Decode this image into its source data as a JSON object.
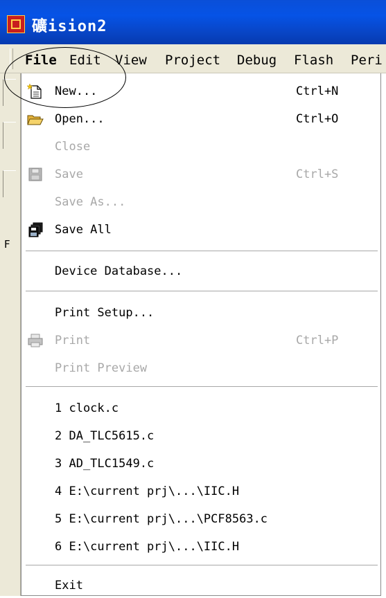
{
  "window": {
    "title": "礦ision2"
  },
  "menubar": {
    "items": [
      {
        "label": "File",
        "active": true
      },
      {
        "label": "Edit"
      },
      {
        "label": "View"
      },
      {
        "label": "Project"
      },
      {
        "label": "Debug"
      },
      {
        "label": "Flash"
      },
      {
        "label": "Peri"
      }
    ]
  },
  "left_panel": {
    "label": "F"
  },
  "file_menu": {
    "new": {
      "label": "New...",
      "shortcut": "Ctrl+N",
      "icon": "new-file-icon"
    },
    "open": {
      "label": "Open...",
      "shortcut": "Ctrl+O",
      "icon": "folder-open-icon"
    },
    "close": {
      "label": "Close"
    },
    "save": {
      "label": "Save",
      "shortcut": "Ctrl+S",
      "icon": "save-disk-icon"
    },
    "save_as": {
      "label": "Save As..."
    },
    "save_all": {
      "label": "Save All",
      "icon": "save-all-icon"
    },
    "device_database": {
      "label": "Device Database..."
    },
    "print_setup": {
      "label": "Print Setup..."
    },
    "print": {
      "label": "Print",
      "shortcut": "Ctrl+P",
      "icon": "printer-icon"
    },
    "print_preview": {
      "label": "Print Preview"
    },
    "recent": [
      {
        "label": "1 clock.c"
      },
      {
        "label": "2 DA_TLC5615.c"
      },
      {
        "label": "3 AD_TLC1549.c"
      },
      {
        "label": "4 E:\\current prj\\...\\IIC.H"
      },
      {
        "label": "5 E:\\current prj\\...\\PCF8563.c"
      },
      {
        "label": "6 E:\\current prj\\...\\IIC.H"
      }
    ],
    "exit": {
      "label": "Exit"
    }
  }
}
